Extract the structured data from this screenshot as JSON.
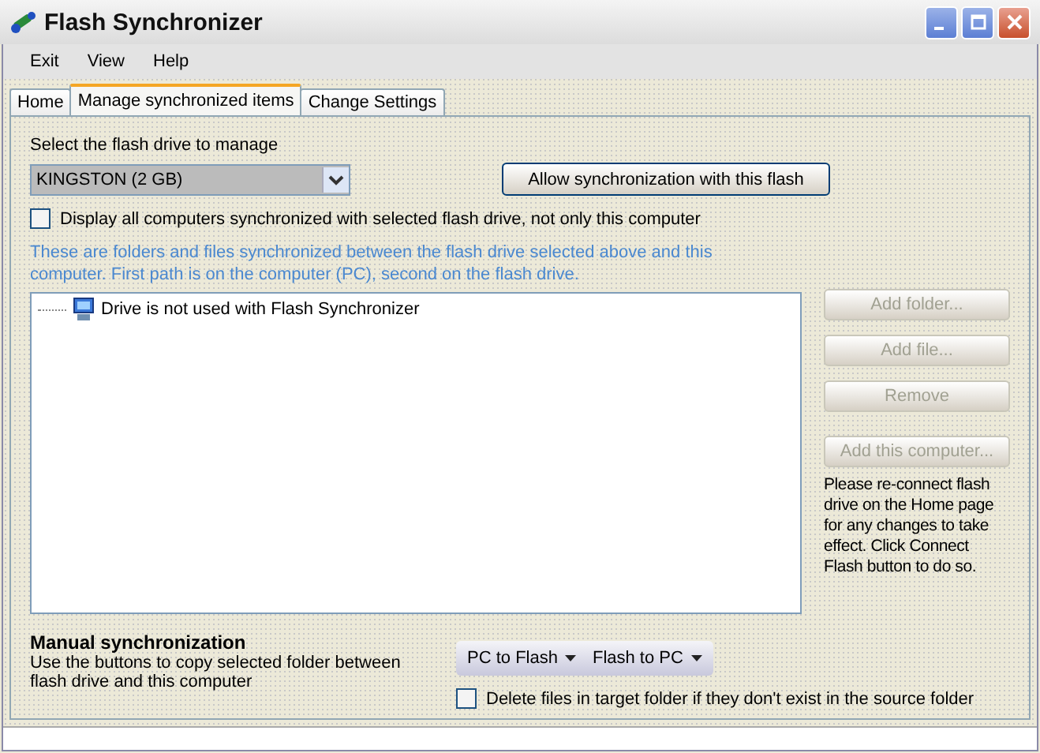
{
  "window": {
    "title": "Flash Synchronizer"
  },
  "menu": [
    "Exit",
    "View",
    "Help"
  ],
  "tabs": [
    {
      "label": "Home",
      "selected": false
    },
    {
      "label": "Manage synchronized items",
      "selected": true
    },
    {
      "label": "Change Settings",
      "selected": false
    }
  ],
  "drive_select": {
    "label": "Select the flash drive to manage",
    "value": "KINGSTON (2 GB)"
  },
  "allow_button": "Allow synchronization with this flash",
  "display_all": {
    "label": "Display all computers synchronized with selected flash drive, not only this computer",
    "checked": false
  },
  "description": "These are folders and files synchronized between the flash drive selected above and this computer. First path is on the computer (PC), second on the flash drive.",
  "tree": [
    {
      "label": "Drive is not used with Flash Synchronizer"
    }
  ],
  "side_buttons": [
    {
      "label": "Add folder...",
      "disabled": true
    },
    {
      "label": "Add file...",
      "disabled": true
    },
    {
      "label": "Remove",
      "disabled": true
    },
    {
      "label": "Add this computer...",
      "disabled": true
    }
  ],
  "notice": "Please re-connect flash drive on the Home page for any changes to take effect. Click Connect Flash button to do so.",
  "manual_sync": {
    "title": "Manual synchronization",
    "description": "Use the buttons to copy selected folder between flash drive and this computer",
    "buttons": [
      "PC to Flash",
      "Flash to PC"
    ],
    "delete_option": {
      "label": "Delete files in target folder if they don't exist in the source folder",
      "checked": false
    }
  }
}
